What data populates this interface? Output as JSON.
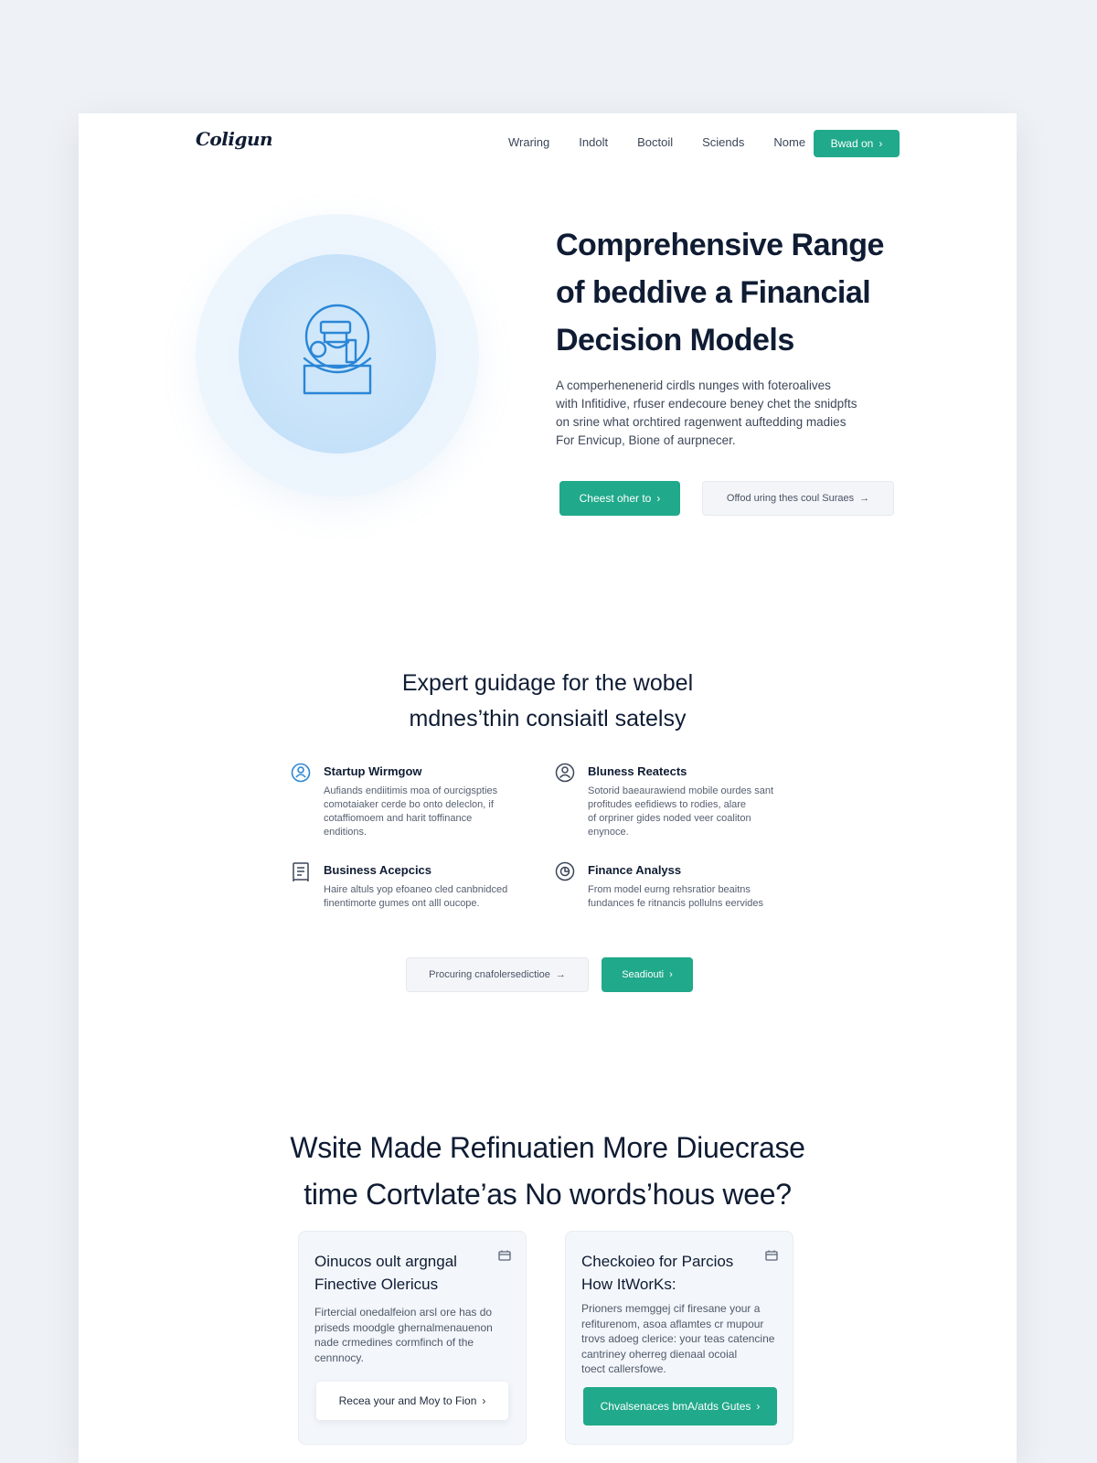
{
  "nav": {
    "logo": "Coligun",
    "links": [
      "Wraring",
      "Indolt",
      "Boctoil",
      "Sciends",
      "Nome"
    ],
    "cta_label": "Bwad on"
  },
  "hero": {
    "title_lines": [
      "Comprehensive Range",
      "of beddive a Financial",
      "Decision Models"
    ],
    "description_lines": [
      "A comperhenenerid cirdls nunges with foteroalives",
      "with Infitidive, rfuser endecoure beney chet the snidpfts",
      "on srine what orchtired ragenwent auftedding madies",
      "For Envicup, Bione of aurpnecer."
    ],
    "primary_button": "Cheest oher to",
    "secondary_button": "Offod uring thes coul Suraes"
  },
  "expert": {
    "title_lines": [
      "Expert guidage for the wobel",
      "mdnes’thin consiaitl satelsy"
    ],
    "features": [
      {
        "icon": "person-circle-icon",
        "title": "Startup Wirmgow",
        "desc_lines": [
          "Aufiands endiitimis moa of ourcigspties",
          "comotaiaker cerde bo onto deleclon, if",
          "cotaffiomoem and harit toffinance",
          "enditions."
        ]
      },
      {
        "icon": "user-circle-icon",
        "title": "Bluness Reatects",
        "desc_lines": [
          "Sotorid baeaurawiend mobile ourdes sant",
          "profitudes eefidiews to rodies, alare",
          "of orpriner gides noded veer coaliton",
          "enynoce."
        ]
      },
      {
        "icon": "clipboard-icon",
        "title": "Business Acepcics",
        "desc_lines": [
          "Haire altuls yop efoaneo cled canbnidced",
          "finentimorte gumes ont alll oucope."
        ]
      },
      {
        "icon": "chart-circle-icon",
        "title": "Finance Analyss",
        "desc_lines": [
          "From model eurng rehsratior beaitns",
          "fundances fe ritnancis pollulns eervides"
        ]
      }
    ],
    "secondary_button": "Procuring cnafolersedictioe",
    "primary_button": "Seadiouti"
  },
  "cta": {
    "title_lines": [
      "Wsite Made Refinuatien More Diuecrase",
      "time Cortvlate’as No words’hous wee?"
    ],
    "cards": [
      {
        "title_lines": [
          "Oinucos oult argngal",
          "Finective Olericus"
        ],
        "icon": "calendar-icon",
        "desc_lines": [
          "Firtercial onedalfeion arsl ore has do",
          "priseds moodgle ghernalmenauenon",
          "nade crmedines cormfinch of the",
          "cennnocy."
        ],
        "button": "Recea your and Moy to Fion"
      },
      {
        "title_lines": [
          "Checkoieo for Parcios",
          "How ItWorKs:"
        ],
        "icon": "calendar-icon",
        "desc_lines": [
          "Prioners memggej cif firesane your a",
          "refiturenom, asoa aflamtes cr mupour",
          "trovs adoeg clerice: your teas catencine",
          "cantriney oherreg dienaal ocoial",
          "toect callersfowe."
        ],
        "button": "Chvalsenaces bmA/atds Gutes"
      }
    ]
  },
  "colors": {
    "accent": "#20a98a",
    "heading": "#0f1c33",
    "hero_circle": "#bfdef8",
    "icon_blue": "#2a86d6"
  }
}
